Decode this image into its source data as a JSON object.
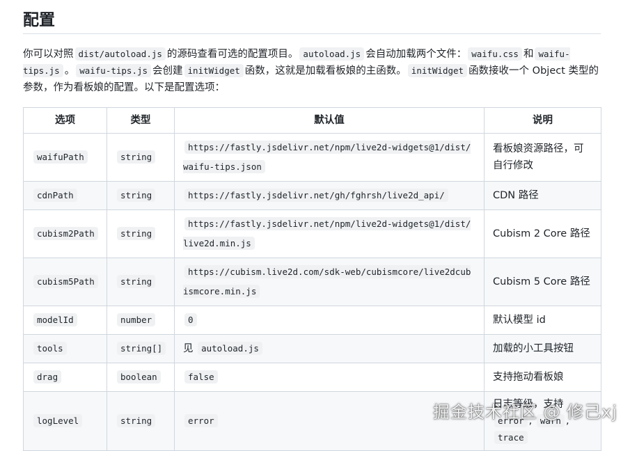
{
  "heading": "配置",
  "intro": {
    "t1": "你可以对照",
    "c1": "dist/autoload.js",
    "t2": "的源码查看可选的配置项目。",
    "c2": "autoload.js",
    "t3": "会自动加载两个文件：",
    "c3": "waifu.css",
    "t4": "和",
    "c4": "waifu-tips.js",
    "t5": "。",
    "c5": "waifu-tips.js",
    "t6": "会创建",
    "c6": "initWidget",
    "t7": "函数，这就是加载看板娘的主函数。",
    "c7": "initWidget",
    "t8": "函数接收一个 Object 类型的参数，作为看板娘的配置。以下是配置选项："
  },
  "table": {
    "headers": [
      "选项",
      "类型",
      "默认值",
      "说明"
    ],
    "rows": [
      {
        "option": "waifuPath",
        "type": "string",
        "value": "https://fastly.jsdelivr.net/npm/live2d-widgets@1/dist/waifu-tips.json",
        "desc": "看板娘资源路径，可自行修改"
      },
      {
        "option": "cdnPath",
        "type": "string",
        "value": "https://fastly.jsdelivr.net/gh/fghrsh/live2d_api/",
        "desc": "CDN 路径"
      },
      {
        "option": "cubism2Path",
        "type": "string",
        "value": "https://fastly.jsdelivr.net/npm/live2d-widgets@1/dist/live2d.min.js",
        "desc": "Cubism 2 Core 路径"
      },
      {
        "option": "cubism5Path",
        "type": "string",
        "value": "https://cubism.live2d.com/sdk-web/cubismcore/live2dcubismcore.min.js",
        "desc": "Cubism 5 Core 路径"
      },
      {
        "option": "modelId",
        "type": "number",
        "value": "0",
        "desc": "默认模型 id"
      },
      {
        "option": "tools",
        "type": "string[]",
        "value_prefix": "见",
        "value": "autoload.js",
        "desc": "加载的小工具按钮"
      },
      {
        "option": "drag",
        "type": "boolean",
        "value": "false",
        "desc": "支持拖动看板娘"
      },
      {
        "option": "logLevel",
        "type": "string",
        "value": "error",
        "desc": "日志等级，支持",
        "desc_codes": [
          "error",
          "warn",
          "trace"
        ]
      }
    ]
  },
  "watermark": "掘金技术社区 @ 修己xj"
}
